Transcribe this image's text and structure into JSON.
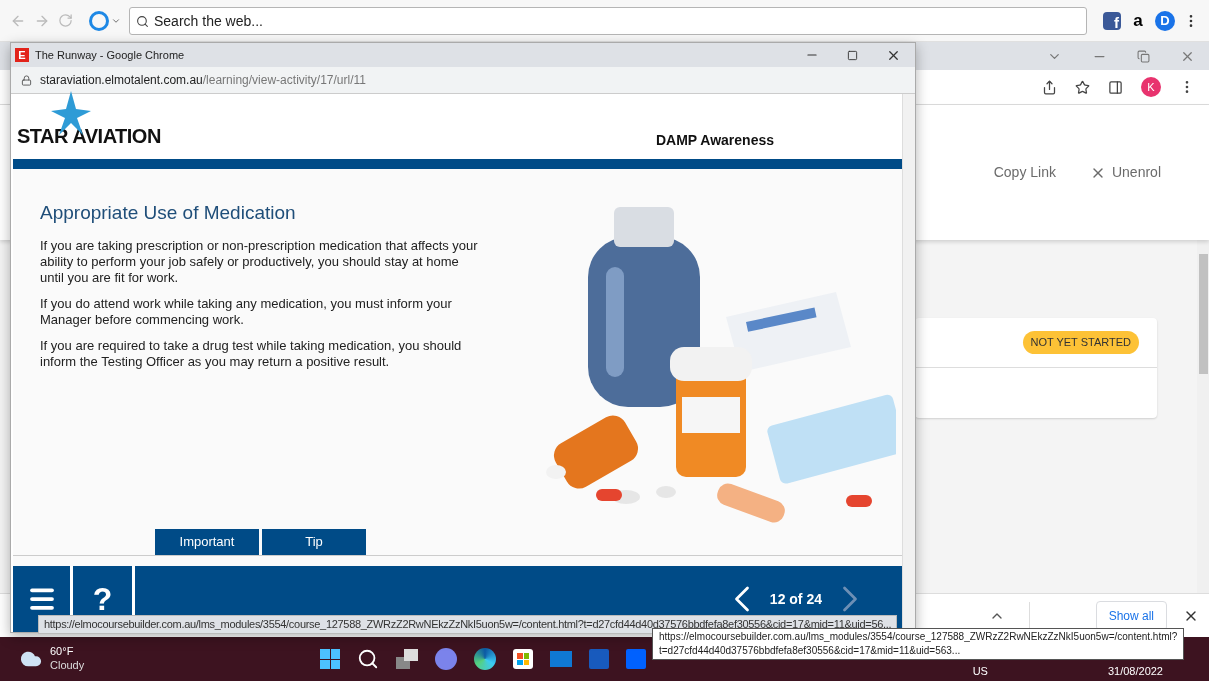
{
  "toolbar": {
    "search": {
      "placeholder": "Search the web..."
    },
    "extensions": [
      {
        "letter": "f",
        "kind": "facebook"
      },
      {
        "letter": "a",
        "kind": "amazon"
      },
      {
        "letter": "D",
        "kind": "disk"
      }
    ]
  },
  "chrome": {
    "profile_initial": "K"
  },
  "page_actions": [
    {
      "label": "Copy Link",
      "kind": "plain"
    },
    {
      "label": "Unenrol",
      "kind": "remove"
    }
  ],
  "course_card": {
    "status": "NOT YET STARTED"
  },
  "downloads_bar": {
    "show_all": "Show all"
  },
  "popup": {
    "favicon_letter": "E",
    "title": "The Runway - Google Chrome",
    "url_host": "staraviation.elmotalent.com.au",
    "url_path": "/learning/view-activity/17/url/11",
    "logo": "STAR AVIATION",
    "course_title": "DAMP Awareness",
    "heading": "Appropriate Use of Medication",
    "paragraphs": [
      "If you are taking prescription or non-prescription medication that affects your ability to perform your job safely or productively, you should stay at home until you are fit for work.",
      "If you do attend work while taking any medication, you must inform your Manager before commencing work.",
      "If you are required to take a drug test while taking medication, you should inform the Testing Officer as you may return a positive result."
    ],
    "tabs": [
      {
        "label": "Important"
      },
      {
        "label": "Tip"
      }
    ],
    "help": "?",
    "page_counter": "12 of 24"
  },
  "status_url": "https://elmocoursebuilder.com.au/lms_modules/3554/course_127588_ZWRzZ2RwNEkzZzNkI5uon5w=/content.html?t=d27cfd44d40d37576bbdfefa8ef30556&cid=17&mid=11&uid=56...",
  "tooltip": {
    "lines": [
      "https://elmocoursebuilder.com.au/lms_modules/3554/course_127588_ZWRzZ2RwNEkzZzNkI5uon5w=/content.html?",
      "t=d27cfd44d40d37576bbdfefa8ef30556&cid=17&mid=11&uid=563..."
    ]
  },
  "taskbar": {
    "weather": {
      "temp": "60°F",
      "condition": "Cloudy"
    },
    "language": "US",
    "date": "31/08/2022"
  }
}
